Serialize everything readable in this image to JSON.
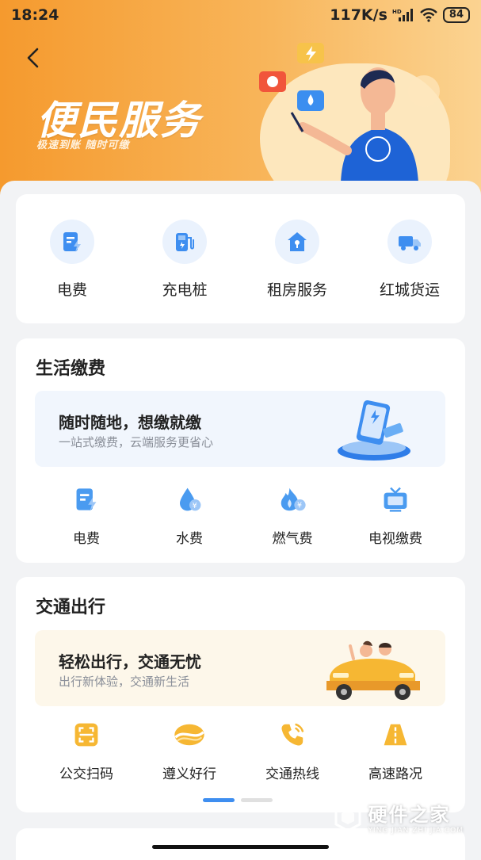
{
  "status_bar": {
    "time": "18:24",
    "network_speed": "117K/s",
    "battery": "84",
    "hd_badge": "HD"
  },
  "header": {
    "title": "便民服务",
    "subtitle": "极速到账 随时可缴",
    "back_icon": "chevron-left-icon",
    "colors": {
      "from": "#f59a2e",
      "to": "#fbd391"
    }
  },
  "quick_services": [
    {
      "label": "电费",
      "icon": "electric-bill-icon"
    },
    {
      "label": "充电桩",
      "icon": "charging-pile-icon"
    },
    {
      "label": "租房服务",
      "icon": "rental-house-icon"
    },
    {
      "label": "红城货运",
      "icon": "truck-icon"
    }
  ],
  "life_payment": {
    "title": "生活缴费",
    "banner_title": "随时随地，想缴就缴",
    "banner_subtitle": "一站式缴费，云端服务更省心",
    "items": [
      {
        "label": "电费",
        "icon": "electric-bill-icon"
      },
      {
        "label": "水费",
        "icon": "water-drop-icon"
      },
      {
        "label": "燃气费",
        "icon": "gas-flame-icon"
      },
      {
        "label": "电视缴费",
        "icon": "tv-icon"
      }
    ]
  },
  "traffic": {
    "title": "交通出行",
    "banner_title": "轻松出行，交通无忧",
    "banner_subtitle": "出行新体验，交通新生活",
    "items": [
      {
        "label": "公交扫码",
        "icon": "scan-code-icon"
      },
      {
        "label": "遵义好行",
        "icon": "route-logo-icon"
      },
      {
        "label": "交通热线",
        "icon": "phone-icon"
      },
      {
        "label": "高速路况",
        "icon": "highway-icon"
      }
    ]
  },
  "pager": {
    "pages": 2,
    "active": 1
  },
  "watermark": {
    "main": "硬件之家",
    "sub": "YING JIAN ZHI JIA.COM"
  },
  "accent": "#3e8ef0"
}
